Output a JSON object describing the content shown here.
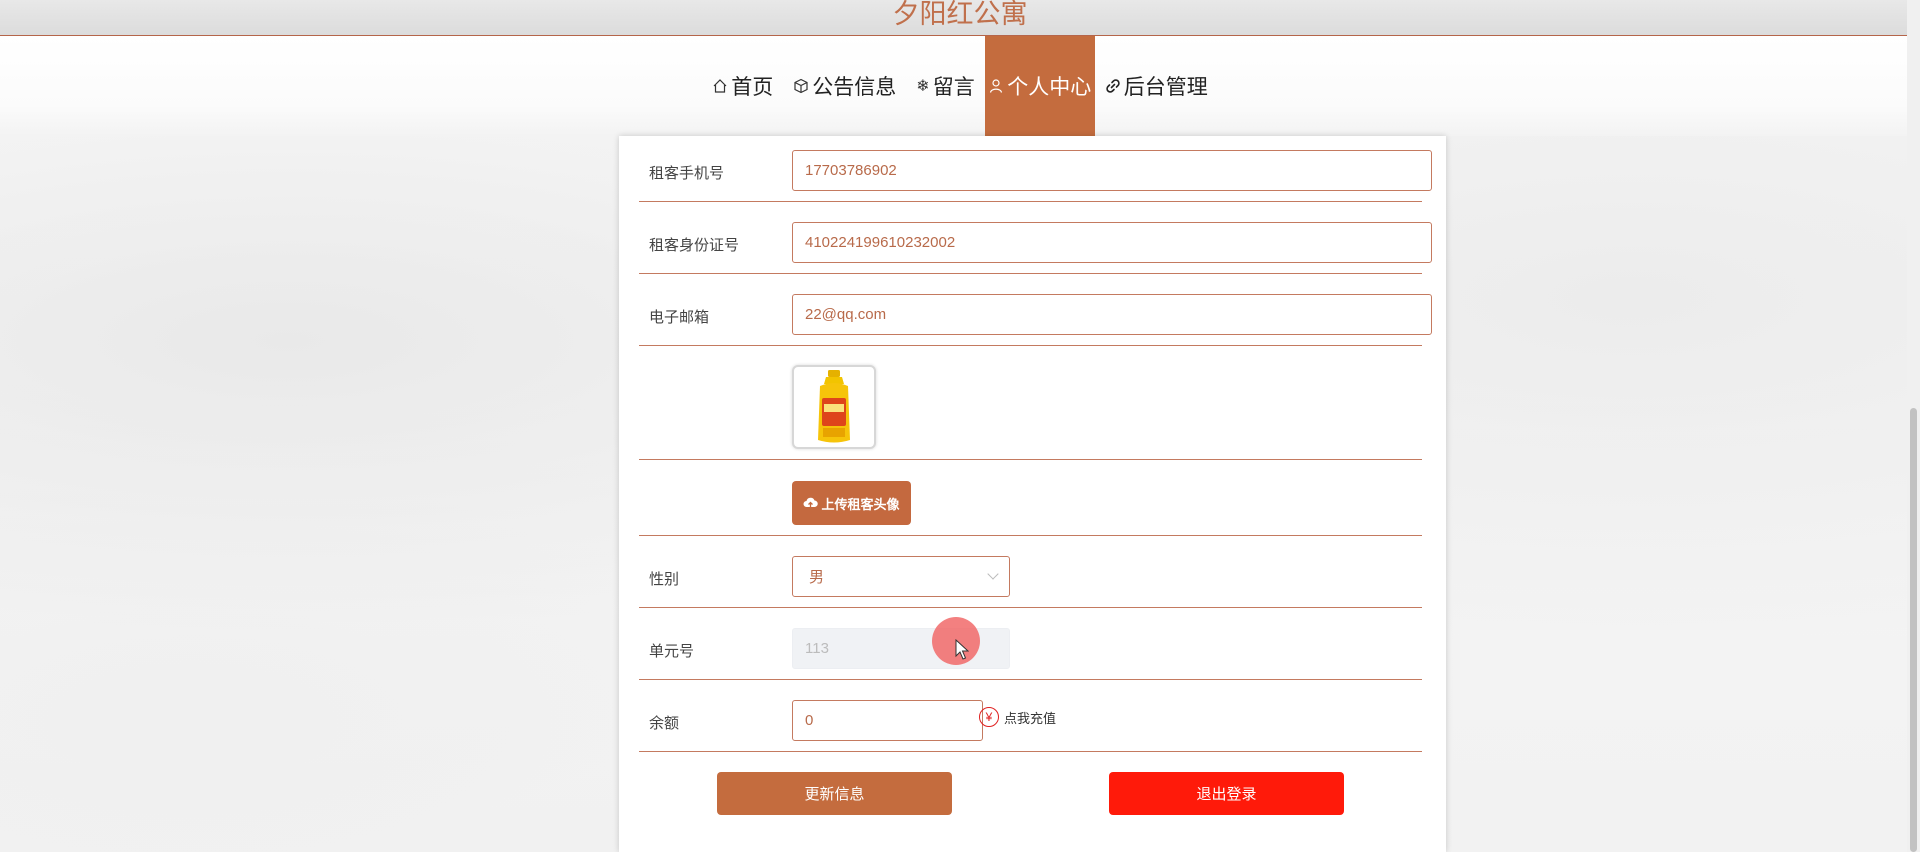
{
  "app": {
    "title": "夕阳红公寓"
  },
  "nav": {
    "items": [
      {
        "label": "首页",
        "icon": "home-icon",
        "active": false
      },
      {
        "label": "公告信息",
        "icon": "cube-icon",
        "active": false
      },
      {
        "label": "留言",
        "icon": "snowflake-icon",
        "active": false
      },
      {
        "label": "个人中心",
        "icon": "user-icon",
        "active": true
      },
      {
        "label": "后台管理",
        "icon": "link-icon",
        "active": false
      }
    ]
  },
  "form": {
    "phone": {
      "label": "租客手机号",
      "value": "17703786902"
    },
    "id_card": {
      "label": "租客身份证号",
      "value": "410224199610232002"
    },
    "email": {
      "label": "电子邮箱",
      "value": "22@qq.com"
    },
    "avatar": {
      "upload_label": "上传租客头像"
    },
    "gender": {
      "label": "性别",
      "value": "男"
    },
    "unit": {
      "label": "单元号",
      "value": "113"
    },
    "balance": {
      "label": "余额",
      "value": "0",
      "recharge_label": "点我充值"
    }
  },
  "actions": {
    "update_label": "更新信息",
    "logout_label": "退出登录"
  },
  "colors": {
    "accent": "#c46c3e",
    "danger": "#ff1a0a",
    "title": "#c0704c"
  }
}
